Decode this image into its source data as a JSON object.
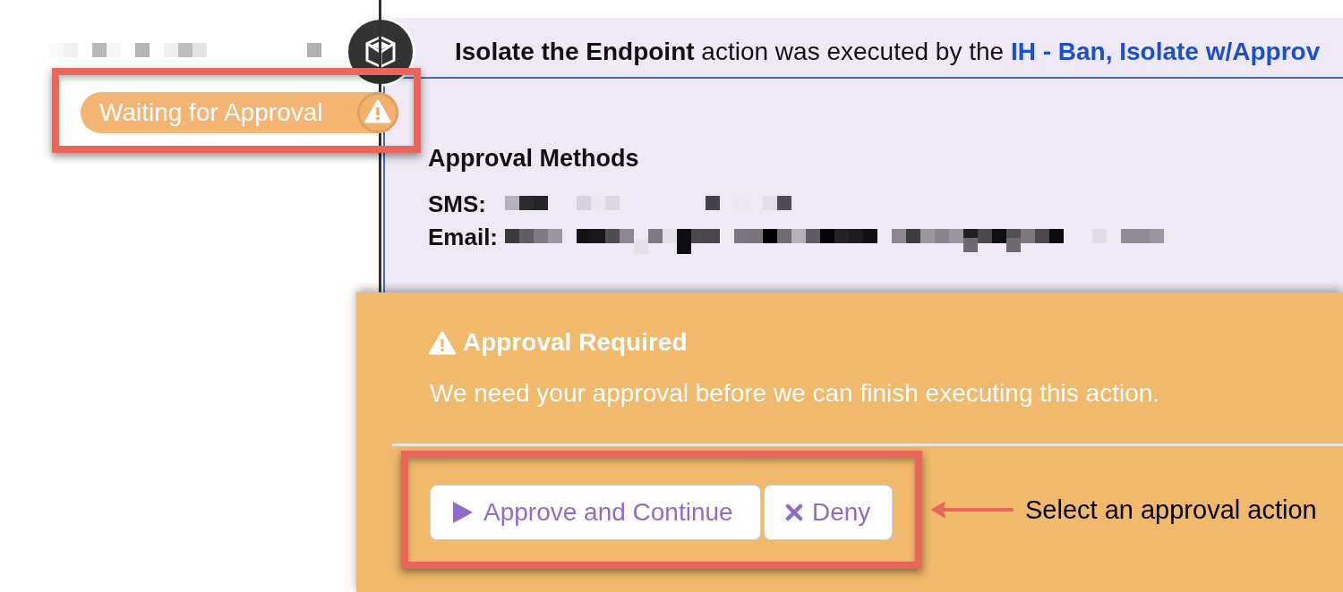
{
  "sidebar": {
    "status_badge": {
      "label": "Waiting for Approval"
    }
  },
  "event": {
    "summary": "**Isolate the Endpoint** action was executed by the",
    "playbook_link": "IH - Ban, Isolate w/Approv",
    "approval_methods": {
      "title": "Approval Methods",
      "methods": [
        {
          "label": "SMS:"
        },
        {
          "label": "Email:"
        }
      ]
    }
  },
  "approval": {
    "title": "Approval Required",
    "message": "We need your approval before we can finish executing this action.",
    "buttons": [
      {
        "kind": "approve",
        "label": "Approve and Continue"
      },
      {
        "kind": "deny",
        "label": "Deny"
      }
    ]
  },
  "annotation": {
    "callout": "Select an approval action"
  }
}
